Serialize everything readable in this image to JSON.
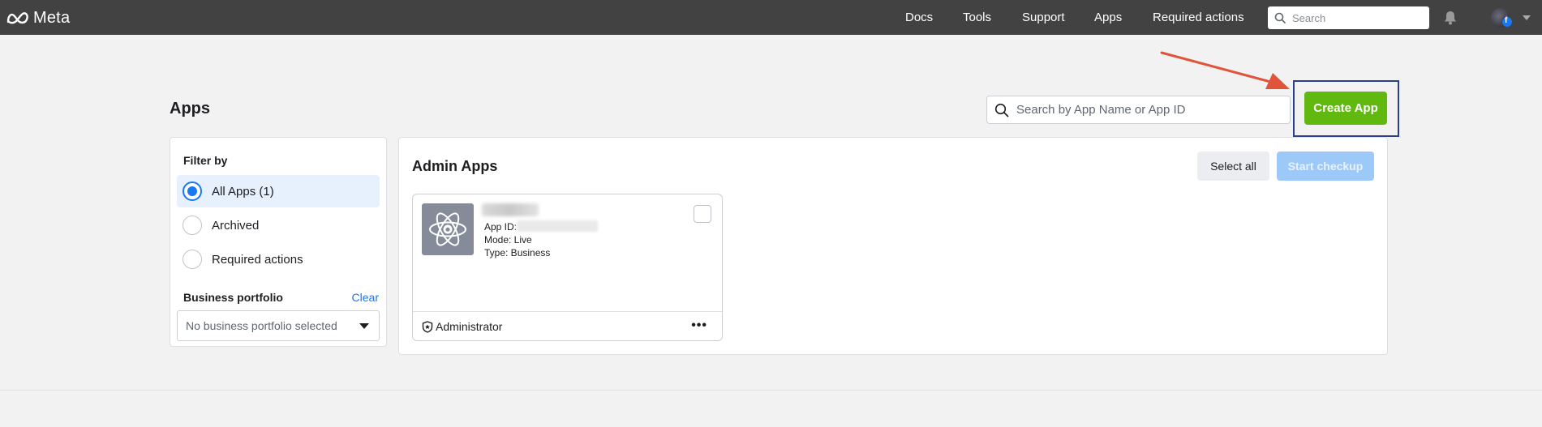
{
  "topbar": {
    "logo": "Meta",
    "nav": [
      "Docs",
      "Tools",
      "Support",
      "Apps",
      "Required actions"
    ],
    "search_placeholder": "Search"
  },
  "page": {
    "title": "Apps",
    "search_placeholder": "Search by App Name or App ID",
    "create_button": "Create App"
  },
  "filter": {
    "heading": "Filter by",
    "options": [
      {
        "label": "All Apps (1)",
        "selected": true
      },
      {
        "label": "Archived",
        "selected": false
      },
      {
        "label": "Required actions",
        "selected": false
      }
    ],
    "portfolio_heading": "Business portfolio",
    "clear_label": "Clear",
    "portfolio_value": "No business portfolio selected"
  },
  "apps_panel": {
    "heading": "Admin Apps",
    "select_all": "Select all",
    "start_checkup": "Start checkup",
    "apps": [
      {
        "id_label": "App ID:",
        "mode": "Mode: Live",
        "type": "Type: Business",
        "role": "Administrator",
        "more": "•••"
      }
    ]
  },
  "colors": {
    "topbar": "#424242",
    "create_button": "#61b80f",
    "highlight_box": "#2b3f8f",
    "arrow": "#e0553a",
    "link": "#1877f2"
  },
  "icons": [
    "meta-logo-icon",
    "search-icon",
    "bell-icon",
    "avatar",
    "caret-down-icon",
    "app-atom-icon",
    "shield-icon"
  ]
}
